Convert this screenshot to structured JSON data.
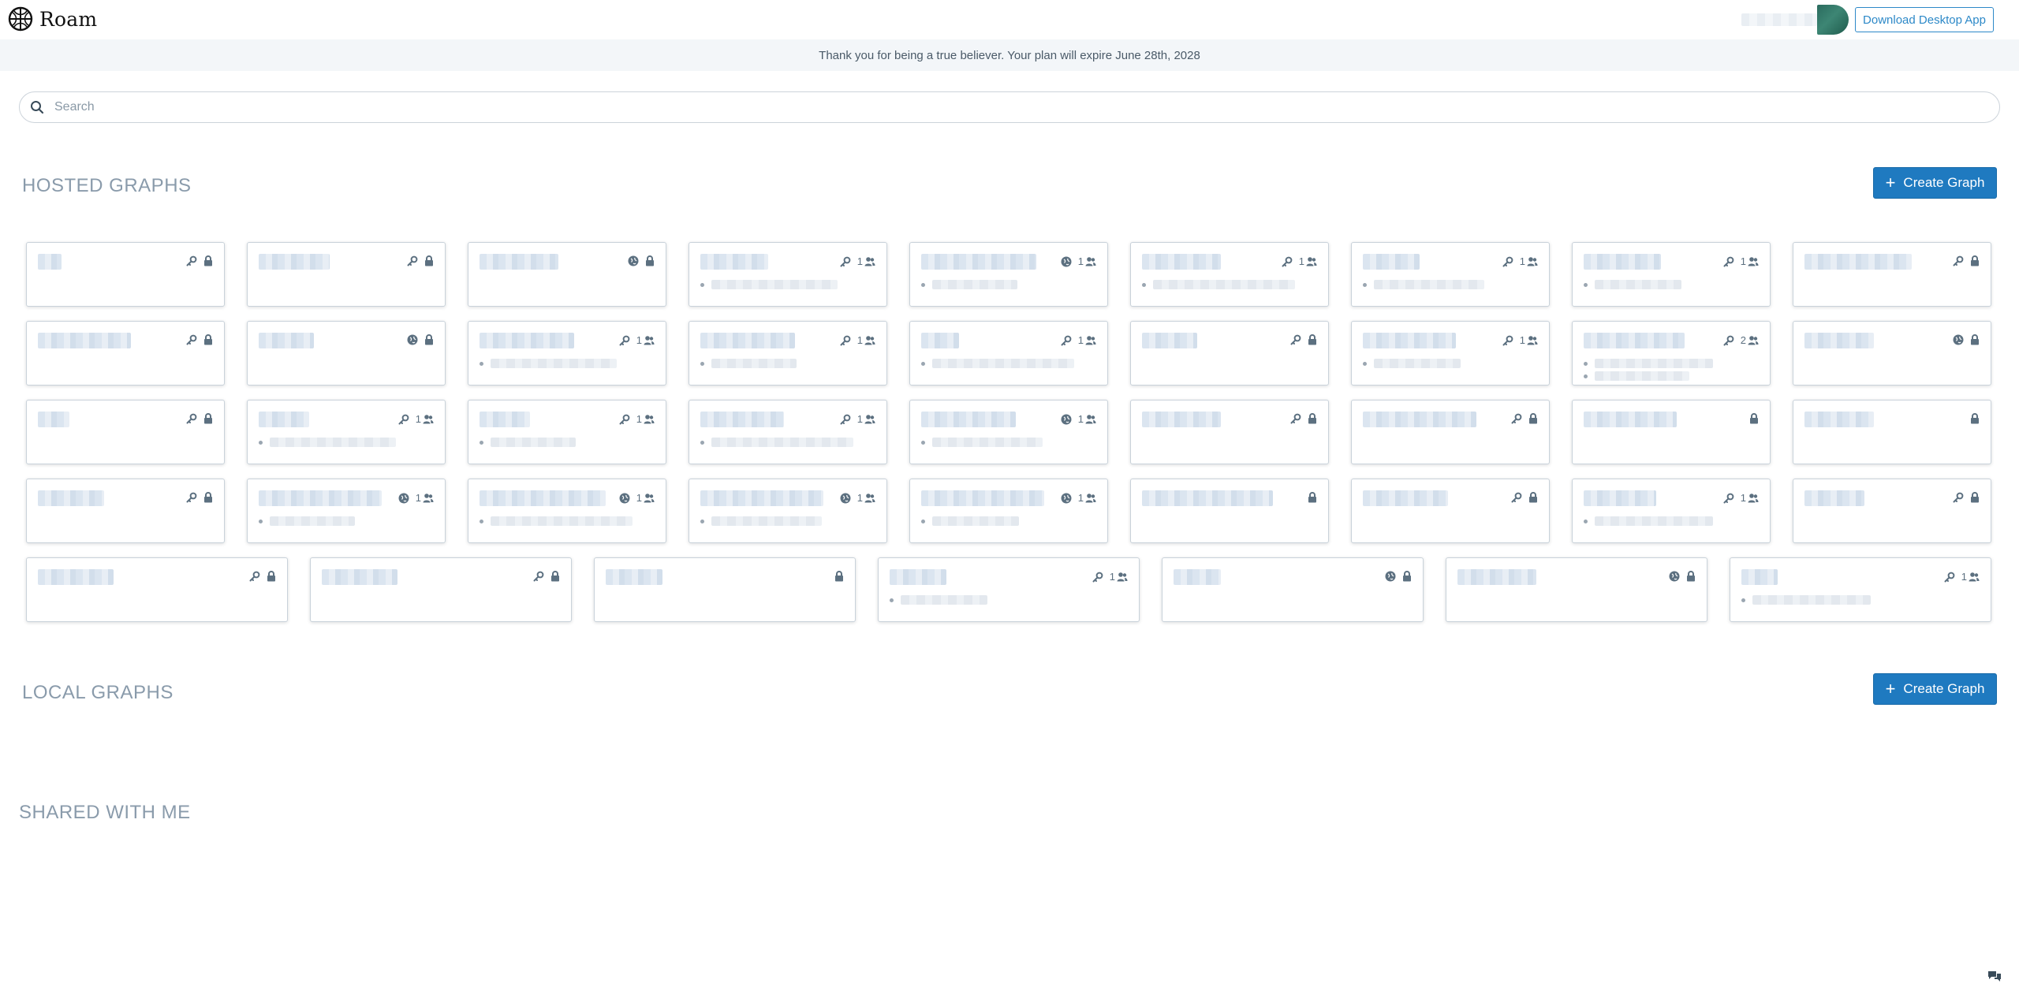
{
  "app": {
    "name": "Roam"
  },
  "header": {
    "download_label": "Download Desktop App"
  },
  "banner": {
    "text": "Thank you for being a true believer. Your plan will expire June 28th, 2028"
  },
  "search": {
    "placeholder": "Search",
    "value": ""
  },
  "sections": {
    "hosted": {
      "title": "HOSTED GRAPHS",
      "create_label": "Create Graph"
    },
    "local": {
      "title": "LOCAL GRAPHS",
      "create_label": "Create Graph"
    },
    "shared": {
      "title": "SHARED WITH ME"
    }
  },
  "hosted_graphs": [
    [
      {
        "access": "key",
        "locked": true,
        "members": null,
        "previews": 0
      },
      {
        "access": "key",
        "locked": true,
        "members": null,
        "previews": 0
      },
      {
        "access": "public",
        "locked": true,
        "members": null,
        "previews": 0
      },
      {
        "access": "key",
        "locked": false,
        "members": "1",
        "previews": 1
      },
      {
        "access": "public",
        "locked": false,
        "members": "1",
        "previews": 1
      },
      {
        "access": "key",
        "locked": false,
        "members": "1",
        "previews": 1
      },
      {
        "access": "key",
        "locked": false,
        "members": "1",
        "previews": 1
      },
      {
        "access": "key",
        "locked": false,
        "members": "1",
        "previews": 1
      },
      {
        "access": "key",
        "locked": true,
        "members": null,
        "previews": 0
      }
    ],
    [
      {
        "access": "key",
        "locked": true,
        "members": null,
        "previews": 0
      },
      {
        "access": "public",
        "locked": true,
        "members": null,
        "previews": 0
      },
      {
        "access": "key",
        "locked": false,
        "members": "1",
        "previews": 1
      },
      {
        "access": "key",
        "locked": false,
        "members": "1",
        "previews": 1
      },
      {
        "access": "key",
        "locked": false,
        "members": "1",
        "previews": 1
      },
      {
        "access": "key",
        "locked": true,
        "members": null,
        "previews": 0
      },
      {
        "access": "key",
        "locked": false,
        "members": "1",
        "previews": 1
      },
      {
        "access": "key",
        "locked": false,
        "members": "2",
        "previews": 2
      },
      {
        "access": "public",
        "locked": true,
        "members": null,
        "previews": 0
      }
    ],
    [
      {
        "access": "key",
        "locked": true,
        "members": null,
        "previews": 0
      },
      {
        "access": "key",
        "locked": false,
        "members": "1",
        "previews": 1
      },
      {
        "access": "key",
        "locked": false,
        "members": "1",
        "previews": 1
      },
      {
        "access": "key",
        "locked": false,
        "members": "1",
        "previews": 1
      },
      {
        "access": "public",
        "locked": false,
        "members": "1",
        "previews": 1
      },
      {
        "access": "key",
        "locked": true,
        "members": null,
        "previews": 0
      },
      {
        "access": "key",
        "locked": true,
        "members": null,
        "previews": 0
      },
      {
        "access": "none",
        "locked": true,
        "members": null,
        "previews": 0
      },
      {
        "access": "none",
        "locked": true,
        "members": null,
        "previews": 0
      }
    ],
    [
      {
        "access": "key",
        "locked": true,
        "members": null,
        "previews": 0
      },
      {
        "access": "public",
        "locked": false,
        "members": "1",
        "previews": 1
      },
      {
        "access": "public",
        "locked": false,
        "members": "1",
        "previews": 1
      },
      {
        "access": "public",
        "locked": false,
        "members": "1",
        "previews": 1
      },
      {
        "access": "public",
        "locked": false,
        "members": "1",
        "previews": 1
      },
      {
        "access": "none",
        "locked": true,
        "members": null,
        "previews": 0
      },
      {
        "access": "key",
        "locked": true,
        "members": null,
        "previews": 0
      },
      {
        "access": "key",
        "locked": false,
        "members": "1",
        "previews": 1
      },
      {
        "access": "key",
        "locked": true,
        "members": null,
        "previews": 0
      }
    ],
    [
      {
        "access": "key",
        "locked": true,
        "members": null,
        "previews": 0
      },
      {
        "access": "key",
        "locked": true,
        "members": null,
        "previews": 0
      },
      {
        "access": "none",
        "locked": true,
        "members": null,
        "previews": 0
      },
      {
        "access": "key",
        "locked": false,
        "members": "1",
        "previews": 1
      },
      {
        "access": "public",
        "locked": true,
        "members": null,
        "previews": 0
      },
      {
        "access": "public",
        "locked": true,
        "members": null,
        "previews": 0
      },
      {
        "access": "key",
        "locked": false,
        "members": "1",
        "previews": 1
      }
    ]
  ],
  "icons": {
    "graph_access_key": "key-icon",
    "graph_access_public": "globe-icon",
    "graph_locked": "lock-icon",
    "graph_members": "people-icon",
    "search": "search-icon",
    "chat": "chat-icon"
  },
  "colors": {
    "primary": "#1f7ac0",
    "link": "#2d89c8",
    "banner_bg": "#f3f6f9",
    "section_title": "#8a9bab"
  }
}
